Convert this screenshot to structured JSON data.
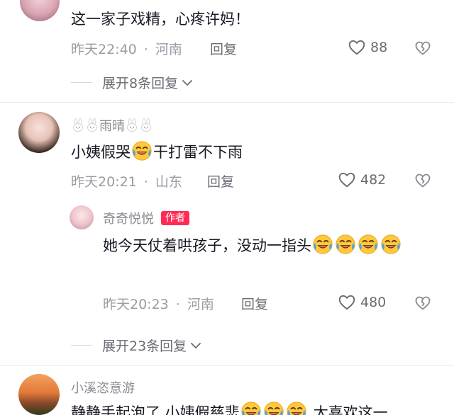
{
  "comments": [
    {
      "text": "这一家子戏精，心疼许妈！",
      "time": "昨天22:40",
      "location": "河南",
      "reply_label": "回复",
      "likes": "88",
      "expand_label": "展开8条回复"
    },
    {
      "username": "雨晴",
      "text_before": "小姨假哭",
      "text_after": "干打雷不下雨",
      "time": "昨天20:21",
      "location": "山东",
      "reply_label": "回复",
      "likes": "482",
      "reply": {
        "username": "奇奇悦悦",
        "badge": "作者",
        "text": "她今天仗着哄孩子，没动一指头",
        "time": "昨天20:23",
        "location": "河南",
        "reply_label": "回复",
        "likes": "480"
      },
      "expand_label": "展开23条回复"
    },
    {
      "username": "小溪恣意游",
      "text_before": "静静手起泡了 小姨假慈悲",
      "text_after": "太喜欢这一"
    }
  ],
  "icons": {
    "like": "heart-outline-icon",
    "dislike": "broken-heart-icon",
    "expand": "chevron-down-icon",
    "emoji": "laughing-crying-face-icon"
  },
  "colors": {
    "accent": "#fe2c55",
    "meta": "#9a9ba3",
    "text": "#161823"
  }
}
